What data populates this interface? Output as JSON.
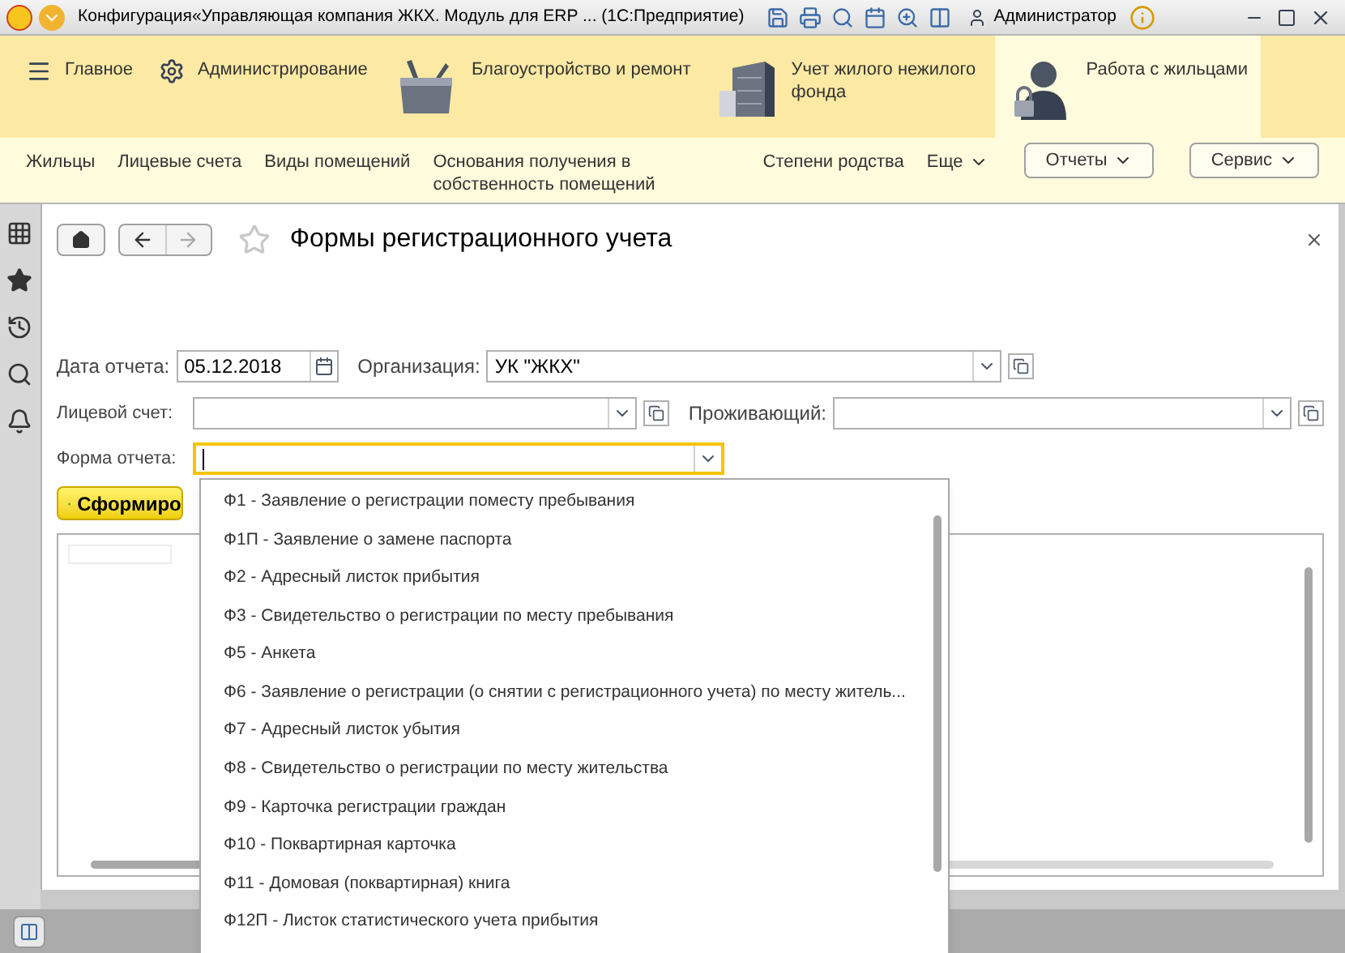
{
  "window": {
    "title": "Конфигурация«Управляющая компания ЖКХ. Модуль для ERP ...  (1С:Предприятие)",
    "user": "Администратор"
  },
  "sections": [
    {
      "label": "Главное",
      "selected": false
    },
    {
      "label": "Администрирование",
      "selected": false
    },
    {
      "label": "Благоустройство и ремонт",
      "selected": false
    },
    {
      "label": "Учет жилого нежилого фонда",
      "selected": false
    },
    {
      "label": "Работа с жильцами",
      "selected": true
    }
  ],
  "nav_links": [
    "Жильцы",
    "Лицевые счета",
    "Виды помещений",
    "Основания получения в собственность помещений",
    "Степени родства"
  ],
  "more_link": "Еще",
  "nav_menus": [
    "Отчеты",
    "Сервис"
  ],
  "form": {
    "title": "Формы регистрационного учета",
    "date": {
      "label": "Дата отчета:",
      "value": "05.12.2018"
    },
    "organization": {
      "label": "Организация:",
      "value": "УК \"ЖКХ\""
    },
    "account": {
      "label": "Лицевой счет:"
    },
    "resident": {
      "label": "Проживающий:"
    },
    "report_form": {
      "label": "Форма отчета:",
      "focused": true
    },
    "generate_button": "Сформиро"
  },
  "dropdown": {
    "items": [
      "Ф1 - Заявление о регистрации поместу пребывания",
      "Ф1П - Заявление о замене паспорта",
      "Ф2 - Адресный листок прибытия",
      "Ф3 - Свидетельство о регистрации по месту пребывания",
      "Ф5 - Анкета",
      "Ф6 - Заявление о регистрации (о снятии с регистрационного учета) по месту житель...",
      "Ф7 - Адресный листок убытия",
      "Ф8 - Свидетельство о регистрации по месту жительства",
      "Ф9 - Карточка регистрации граждан",
      "Ф10 - Поквартирная карточка",
      "Ф11 - Домовая (поквартирная) книга",
      "Ф12П - Листок статистического учета прибытия"
    ]
  }
}
